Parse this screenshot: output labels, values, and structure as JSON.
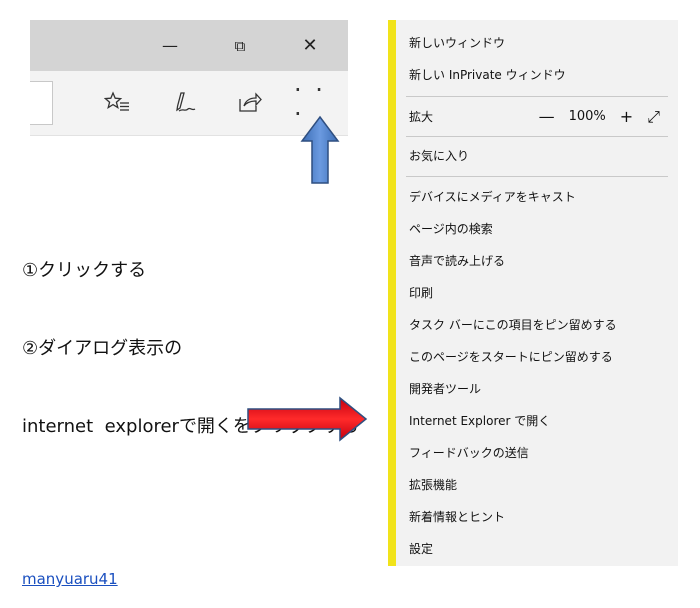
{
  "browser": {
    "window_controls": {
      "minimize": "—",
      "restore": "⧉",
      "close": "✕"
    },
    "toolbar": {
      "favorites_icon": "star-list-icon",
      "notes_icon": "pen-icon",
      "share_icon": "share-icon",
      "more_label": "· · ·"
    }
  },
  "instructions": [
    "①クリックする",
    "②ダイアログ表示の",
    "internet  explorerで開くをクリックする"
  ],
  "link": {
    "text": "manyuaru41"
  },
  "menu": {
    "accent_color": "#f1e31a",
    "items": [
      "新しいウィンドウ",
      "新しい InPrivate ウィンドウ",
      "拡大",
      "お気に入り",
      "デバイスにメディアをキャスト",
      "ページ内の検索",
      "音声で読み上げる",
      "印刷",
      "タスク バーにこの項目をピン留めする",
      "このページをスタートにピン留めする",
      "開発者ツール",
      "Internet Explorer で開く",
      "フィードバックの送信",
      "拡張機能",
      "新着情報とヒント",
      "設定"
    ],
    "zoom": {
      "minus": "—",
      "value": "100%",
      "plus": "+",
      "fullscreen": "⤢"
    }
  },
  "colors": {
    "up_arrow": "#4a7ec4",
    "right_arrow": "#e0101a",
    "arrow_outline": "#2f4f80"
  }
}
